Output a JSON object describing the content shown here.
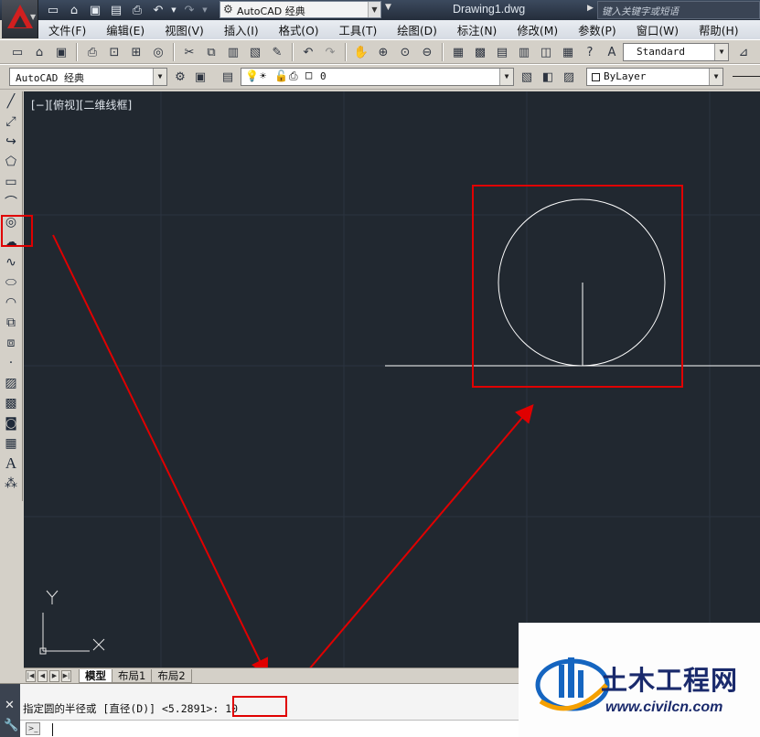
{
  "titlebar": {
    "workspace": "AutoCAD 经典",
    "document_title": "Drawing1.dwg",
    "search_placeholder": "键入关键字或短语"
  },
  "menu": [
    "文件(F)",
    "编辑(E)",
    "视图(V)",
    "插入(I)",
    "格式(O)",
    "工具(T)",
    "绘图(D)",
    "标注(N)",
    "修改(M)",
    "参数(P)",
    "窗口(W)",
    "帮助(H)"
  ],
  "toolbar": {
    "text_style": "Standard",
    "workspace_combo": "AutoCAD 经典",
    "layer_name": "0",
    "color_combo": "ByLayer"
  },
  "viewport": {
    "label": "[−][俯视][二维线框]",
    "ucs_x": "X",
    "ucs_y": "Y"
  },
  "layout_tabs": [
    "模型",
    "布局1",
    "布局2"
  ],
  "command_line": {
    "history": "指定圆的半径或 [直径(D)] <5.2891>: 10",
    "input": ""
  },
  "watermark": {
    "name": "土木工程网",
    "url": "www.civilcn.com"
  },
  "colors": {
    "canvas_bg": "#212830",
    "highlight": "#e00000",
    "geometry": "#ffffff"
  }
}
